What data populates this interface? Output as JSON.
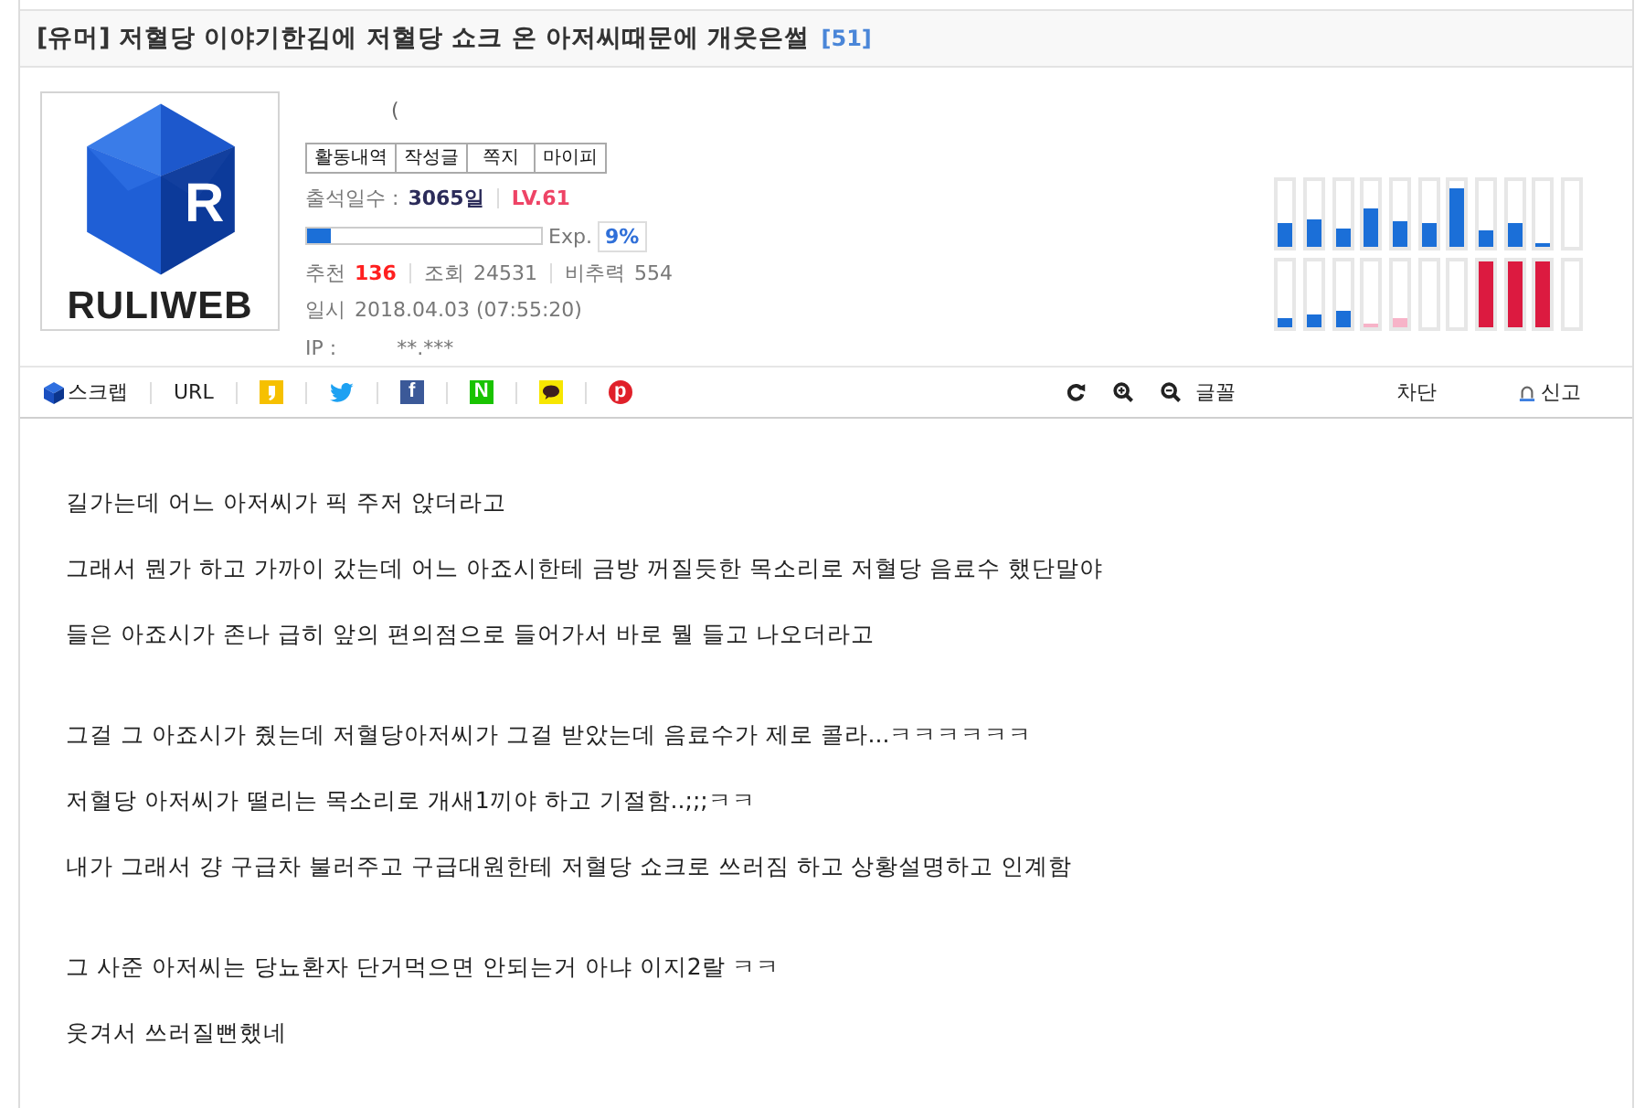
{
  "post": {
    "title": "[유머] 저혈당 이야기한김에 저혈당 쇼크 온 아저씨때문에 개웃은썰",
    "comment_count": "[51]"
  },
  "profile": {
    "logo": {
      "mark": "R",
      "wordmark": "RULIWEB"
    },
    "nickname": "(",
    "buttons": [
      "활동내역",
      "작성글",
      "쪽지",
      "마이피"
    ],
    "attendance": {
      "label": "출석일수 :",
      "value": "3065일"
    },
    "level_label": "LV.61",
    "exp": {
      "level": 0.1,
      "label": "Exp.",
      "percent": "9%"
    },
    "stats": [
      {
        "label": "추천",
        "value": "136",
        "emphasis": true
      },
      {
        "label": "조회",
        "value": "24531",
        "emphasis": false
      },
      {
        "label": "비추력",
        "value": "554",
        "emphasis": false
      }
    ],
    "date": {
      "label": "일시",
      "value": "2018.04.03 (07:55:20)"
    },
    "ip": {
      "label": "IP :",
      "value": "**.***"
    }
  },
  "activity_meters": {
    "top": [
      {
        "level": 0.35,
        "color": "#1b6fd8"
      },
      {
        "level": 0.43,
        "color": "#1b6fd8"
      },
      {
        "level": 0.29,
        "color": "#1b6fd8"
      },
      {
        "level": 0.58,
        "color": "#1b6fd8"
      },
      {
        "level": 0.39,
        "color": "#1b6fd8"
      },
      {
        "level": 0.35,
        "color": "#1b6fd8"
      },
      {
        "level": 0.88,
        "color": "#1b6fd8"
      },
      {
        "level": 0.24,
        "color": "#1b6fd8"
      },
      {
        "level": 0.35,
        "color": "#1b6fd8"
      },
      {
        "level": 0.05,
        "color": "#1b6fd8"
      },
      {
        "level": 0
      }
    ],
    "bottom": [
      {
        "level": 0.15,
        "color": "#1b6fd8"
      },
      {
        "level": 0.2,
        "color": "#1b6fd8"
      },
      {
        "level": 0.25,
        "color": "#1b6fd8"
      },
      {
        "level": 0.05,
        "color": "#f7b3c8"
      },
      {
        "level": 0.15,
        "color": "#f7b3c8"
      },
      {
        "level": 0
      },
      {
        "level": 0
      },
      {
        "level": 1,
        "color": "#dc1a40"
      },
      {
        "level": 1,
        "color": "#dc1a40"
      },
      {
        "level": 1,
        "color": "#dc1a40"
      },
      {
        "level": 0
      }
    ]
  },
  "toolbar": {
    "share": [
      {
        "kind": "scrap",
        "label": "스크랩"
      },
      {
        "kind": "url",
        "label": "URL"
      },
      {
        "kind": "quote"
      },
      {
        "kind": "bird"
      },
      {
        "kind": "tile",
        "glyph": "f",
        "color": "#3b5998"
      },
      {
        "kind": "tile",
        "glyph": "N",
        "color": "#19c300"
      },
      {
        "kind": "chat"
      },
      {
        "kind": "circle",
        "glyph": "p",
        "color": "#e0202a"
      }
    ],
    "tools": [
      {
        "kind": "refresh"
      },
      {
        "kind": "zoom-in"
      },
      {
        "kind": "zoom-out"
      },
      {
        "kind": "font",
        "label": "글꼴"
      }
    ],
    "actions": [
      {
        "kind": "block",
        "label": "차단"
      },
      {
        "kind": "report",
        "label": "신고"
      }
    ]
  },
  "body": {
    "paragraphs": [
      [
        "길가는데 어느 아저씨가 픽 주저 앉더라고",
        "그래서 뭔가 하고 가까이 갔는데 어느 아죠시한테 금방 꺼질듯한 목소리로 저혈당 음료수 했단말야",
        "들은 아죠시가 존나 급히 앞의 편의점으로 들어가서 바로 뭘 들고 나오더라고"
      ],
      [
        "그걸 그 아죠시가 줬는데 저혈당아저씨가 그걸 받았는데 음료수가 제로 콜라...ㅋㅋㅋㅋㅋㅋ",
        "저혈당 아저씨가 떨리는 목소리로 개새1끼야 하고 기절함..;;;ㅋㅋ",
        "내가 그래서 걍 구급차 불러주고 구급대원한테 저혈당 쇼크로 쓰러짐 하고 상황설명하고 인계함"
      ],
      [
        "그 사준 아저씨는 당뇨환자 단거먹으면 안되는거 아냐 이지2랄 ㅋㅋ",
        "웃겨서 쓰러질뻔했네"
      ]
    ]
  }
}
